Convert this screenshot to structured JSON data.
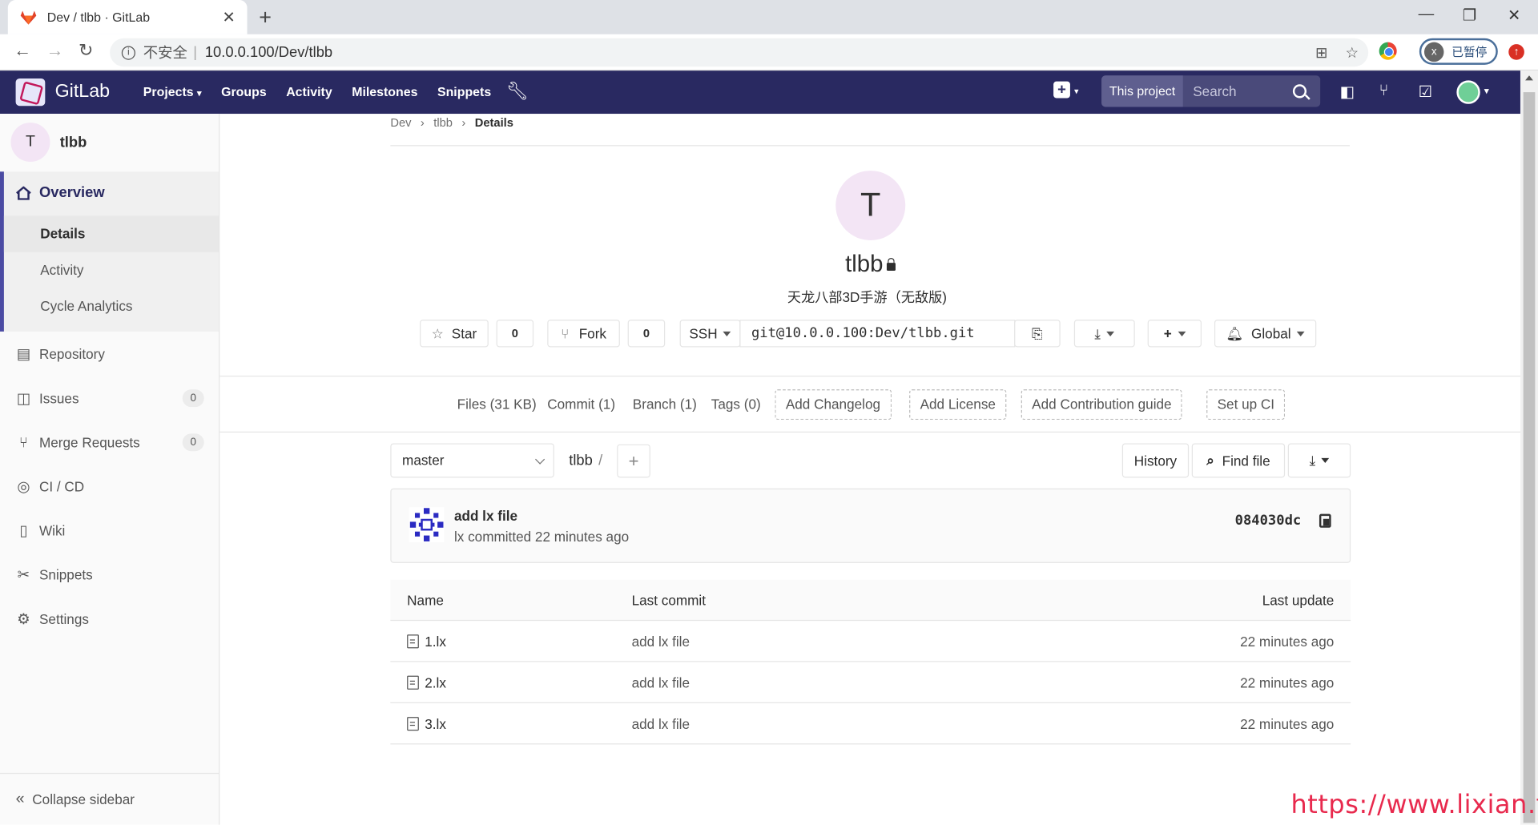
{
  "browser": {
    "tab_title": "Dev / tlbb · GitLab",
    "insecure_label": "不安全",
    "url": "10.0.0.100/Dev/tlbb",
    "profile_initial": "x",
    "profile_status": "已暂停",
    "update_badge": "↑"
  },
  "gitlab": {
    "brand": "GitLab",
    "menu": [
      "Projects",
      "Groups",
      "Activity",
      "Milestones",
      "Snippets"
    ],
    "search_scope": "This project",
    "search_placeholder": "Search"
  },
  "sidebar": {
    "project_initial": "T",
    "project_name": "tlbb",
    "overview_label": "Overview",
    "overview_items": [
      {
        "label": "Details",
        "active": true
      },
      {
        "label": "Activity",
        "active": false
      },
      {
        "label": "Cycle Analytics",
        "active": false
      }
    ],
    "items": [
      {
        "label": "Repository",
        "icon": "repository-icon"
      },
      {
        "label": "Issues",
        "icon": "issues-icon",
        "count": "0"
      },
      {
        "label": "Merge Requests",
        "icon": "merge-request-icon",
        "count": "0"
      },
      {
        "label": "CI / CD",
        "icon": "rocket-icon"
      },
      {
        "label": "Wiki",
        "icon": "book-icon"
      },
      {
        "label": "Snippets",
        "icon": "scissors-icon"
      },
      {
        "label": "Settings",
        "icon": "gear-icon"
      }
    ],
    "collapse_label": "Collapse sidebar"
  },
  "breadcrumb": [
    "Dev",
    "tlbb",
    "Details"
  ],
  "project": {
    "initial": "T",
    "name": "tlbb",
    "description": "天龙八部3D手游（无敌版)",
    "star_label": "Star",
    "star_count": "0",
    "fork_label": "Fork",
    "fork_count": "0",
    "clone_protocol": "SSH",
    "clone_url": "git@10.0.0.100:Dev/tlbb.git",
    "notification_level": "Global"
  },
  "stats": {
    "files": "Files (31 KB)",
    "commits": "Commit (1)",
    "branches": "Branch (1)",
    "tags": "Tags (0)",
    "add_changelog": "Add Changelog",
    "add_license": "Add License",
    "add_contribution": "Add Contribution guide",
    "setup_ci": "Set up CI"
  },
  "tree": {
    "branch": "master",
    "path": "tlbb",
    "path_separator": "/",
    "history_label": "History",
    "find_file_label": "Find file"
  },
  "last_commit": {
    "message": "add lx file",
    "meta": "lx committed 22 minutes ago",
    "sha": "084030dc"
  },
  "files_table": {
    "headers": [
      "Name",
      "Last commit",
      "Last update"
    ],
    "rows": [
      {
        "name": "1.lx",
        "commit": "add lx file",
        "updated": "22 minutes ago"
      },
      {
        "name": "2.lx",
        "commit": "add lx file",
        "updated": "22 minutes ago"
      },
      {
        "name": "3.lx",
        "commit": "add lx file",
        "updated": "22 minutes ago"
      }
    ]
  },
  "watermark": "https://www.lixian.fun",
  "colors": {
    "navbar": "#292961",
    "accent": "#4b4ba3",
    "watermark": "#e8294d"
  }
}
